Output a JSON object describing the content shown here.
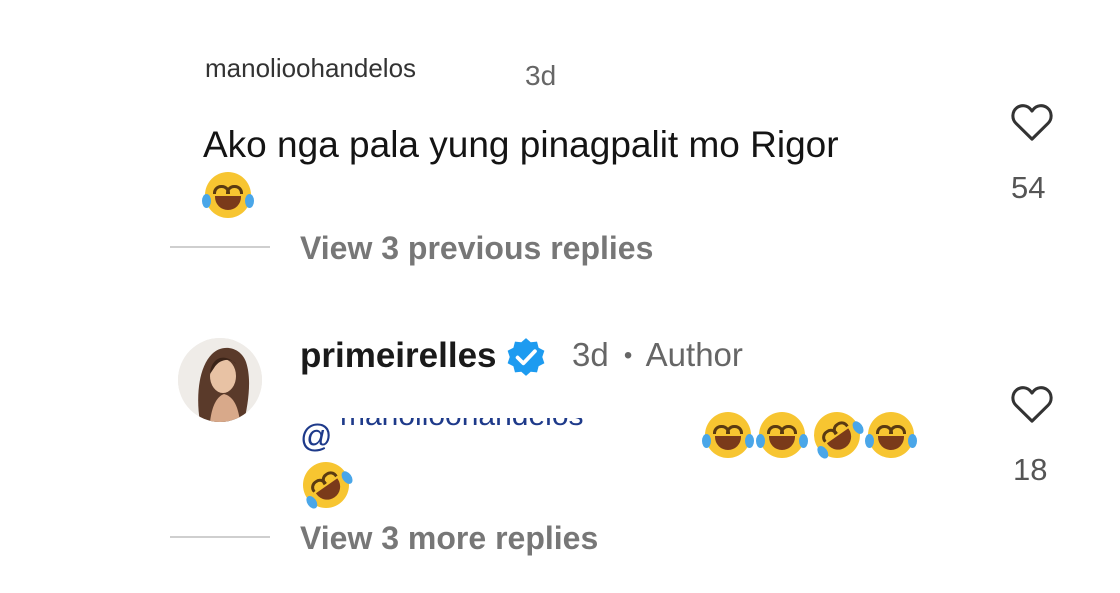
{
  "comment1": {
    "username": "manolioohandelos",
    "timestamp": "3d",
    "text": "Ako nga pala yung pinagpalit mo Rigor",
    "like_count": "54",
    "view_previous_label": "View 3 previous replies"
  },
  "reply1": {
    "username": "primeirelles",
    "verified": true,
    "timestamp": "3d",
    "separator": "•",
    "author_label": "Author",
    "mention_prefix": "@",
    "mention_handle": "manolioohandelos",
    "like_count": "18",
    "view_more_label": "View 3 more replies"
  },
  "colors": {
    "verified_badge": "#1d9bf0",
    "emoji_face": "#f7c531",
    "muted_text": "#777777"
  }
}
